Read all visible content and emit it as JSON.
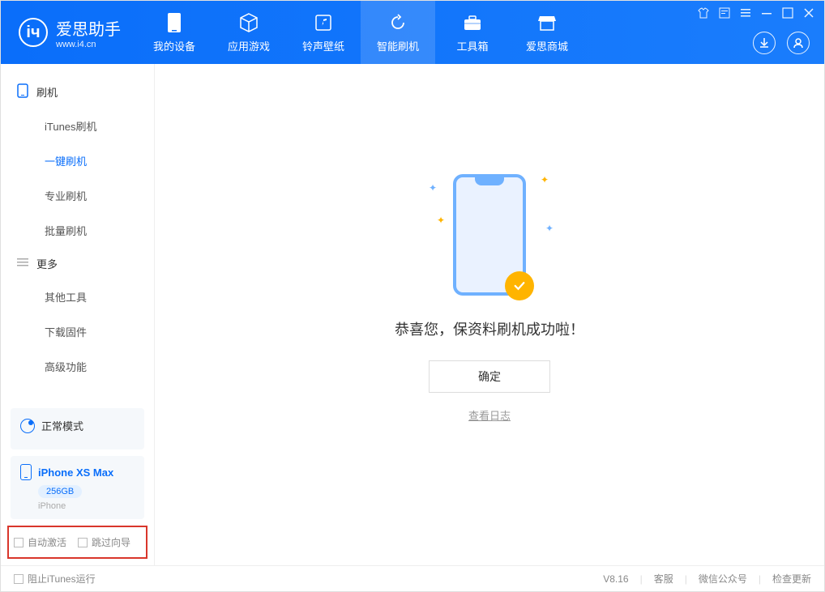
{
  "app": {
    "name": "爱思助手",
    "url": "www.i4.cn"
  },
  "header_tabs": [
    {
      "label": "我的设备"
    },
    {
      "label": "应用游戏"
    },
    {
      "label": "铃声壁纸"
    },
    {
      "label": "智能刷机"
    },
    {
      "label": "工具箱"
    },
    {
      "label": "爱思商城"
    }
  ],
  "sidebar": {
    "group1": "刷机",
    "items1": [
      "iTunes刷机",
      "一键刷机",
      "专业刷机",
      "批量刷机"
    ],
    "group2": "更多",
    "items2": [
      "其他工具",
      "下载固件",
      "高级功能"
    ]
  },
  "device": {
    "mode": "正常模式",
    "name": "iPhone XS Max",
    "capacity": "256GB",
    "type": "iPhone"
  },
  "side_checks": {
    "auto_activate": "自动激活",
    "skip_guide": "跳过向导"
  },
  "main": {
    "message": "恭喜您，保资料刷机成功啦！",
    "confirm": "确定",
    "view_log": "查看日志"
  },
  "footer": {
    "block_itunes": "阻止iTunes运行",
    "version": "V8.16",
    "support": "客服",
    "wechat": "微信公众号",
    "check_update": "检查更新"
  }
}
